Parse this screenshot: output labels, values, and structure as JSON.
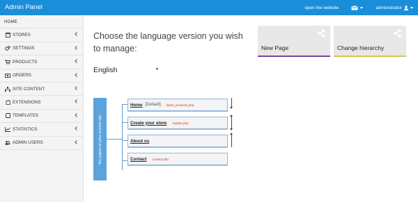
{
  "header": {
    "brand": "Admin Panel",
    "open_website": "open the website",
    "user": "administrator"
  },
  "sidebar": {
    "items": [
      {
        "label": "HOME",
        "icon": "",
        "chevron": false
      },
      {
        "label": "STORES",
        "icon": "hourglass-icon",
        "chevron": true
      },
      {
        "label": "SETTINGS",
        "icon": "gears-icon",
        "chevron": true
      },
      {
        "label": "PRODUCTS",
        "icon": "cart-icon",
        "chevron": true
      },
      {
        "label": "ORDERS",
        "icon": "money-icon",
        "chevron": true
      },
      {
        "label": "SITE CONTENT",
        "icon": "sitemap-icon",
        "chevron": true
      },
      {
        "label": "EXTENSIONS",
        "icon": "puzzle-icon",
        "chevron": true
      },
      {
        "label": "TEMPLATES",
        "icon": "square-icon",
        "chevron": true
      },
      {
        "label": "STATISTICS",
        "icon": "chart-icon",
        "chevron": true
      },
      {
        "label": "ADMIN USERS",
        "icon": "users-icon",
        "chevron": true
      }
    ]
  },
  "main": {
    "title": "Choose the language version you wish to manage:",
    "language_select": {
      "value": "English"
    }
  },
  "tiles": [
    {
      "label": "New Page",
      "bar_color": "#7b3fa0"
    },
    {
      "label": "Change hierarchy",
      "bar_color": "#d6c84a"
    }
  ],
  "diagram": {
    "side_label": "the pages of your current site",
    "pages": [
      {
        "name": "Home",
        "tag": "[Default]",
        "file": "latest_products.php"
      },
      {
        "name": "Create your store",
        "tag": "",
        "file": "register.php"
      },
      {
        "name": "About us",
        "tag": "",
        "file": ""
      },
      {
        "name": "Contact",
        "tag": "",
        "file": "contact.php"
      }
    ]
  },
  "colors": {
    "topbar": "#1a8ed9",
    "diagram_bar": "#5ba3dc",
    "file_text": "#e0312e"
  }
}
